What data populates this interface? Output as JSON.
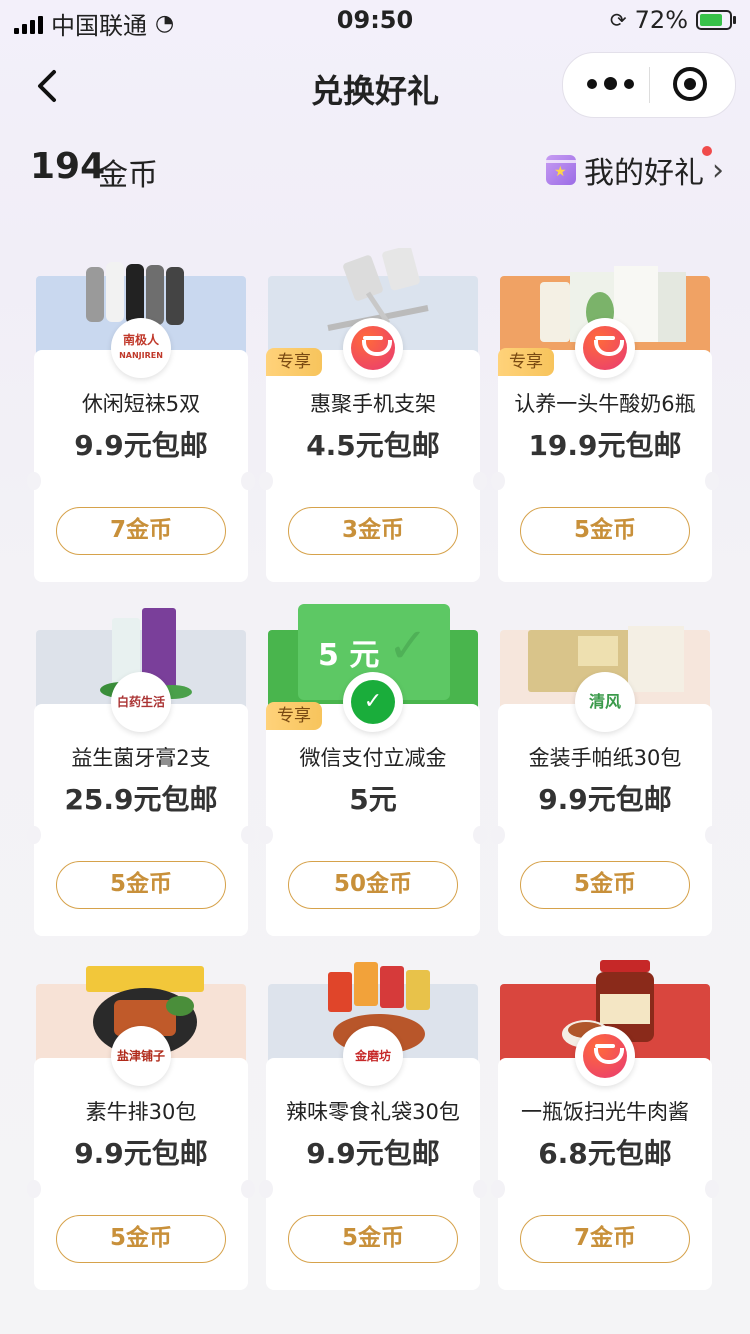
{
  "status_bar": {
    "carrier": "中国联通",
    "time": "09:50",
    "battery": "72%"
  },
  "nav": {
    "title": "兑换好礼"
  },
  "header": {
    "coins": "194",
    "coin_unit": "金币",
    "my_gifts": "我的好礼"
  },
  "products": [
    {
      "name": "休闲短袜5双",
      "price": "9.9元包邮",
      "cost": "7金币",
      "exclusive": false,
      "brand": "南极人 NANJIREN",
      "bg": "#c9d8ef"
    },
    {
      "name": "惠聚手机支架",
      "price": "4.5元包邮",
      "cost": "3金币",
      "exclusive": true,
      "brand": "huiju-icon",
      "bg": "#dbe3ee"
    },
    {
      "name": "认养一头牛酸奶6瓶",
      "price": "19.9元包邮",
      "cost": "5金币",
      "exclusive": true,
      "brand": "huiju-icon",
      "bg": "#f0a264"
    },
    {
      "name": "益生菌牙膏2支",
      "price": "25.9元包邮",
      "cost": "5金币",
      "exclusive": false,
      "brand": "白药生活",
      "bg": "#dde2ea"
    },
    {
      "name": "微信支付立减金",
      "price": "5元",
      "cost": "50金币",
      "exclusive": true,
      "brand": "wechat-pay-icon",
      "bg": "#49b54d",
      "voucher": "5 元"
    },
    {
      "name": "金装手帕纸30包",
      "price": "9.9元包邮",
      "cost": "5金币",
      "exclusive": false,
      "brand": "清风",
      "bg": "#f6e6dc"
    },
    {
      "name": "素牛排30包",
      "price": "9.9元包邮",
      "cost": "5金币",
      "exclusive": false,
      "brand": "盐津铺子",
      "bg": "#f7e2d6"
    },
    {
      "name": "辣味零食礼袋30包",
      "price": "9.9元包邮",
      "cost": "5金币",
      "exclusive": false,
      "brand": "金磨坊",
      "bg": "#dde3ec"
    },
    {
      "name": "一瓶饭扫光牛肉酱",
      "price": "6.8元包邮",
      "cost": "7金币",
      "exclusive": false,
      "brand": "huiju-icon",
      "bg": "#d9463e"
    }
  ],
  "labels": {
    "exclusive": "专享"
  }
}
